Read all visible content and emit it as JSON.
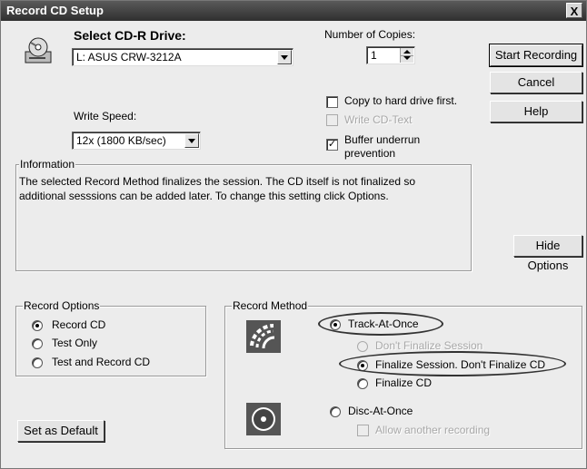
{
  "window": {
    "title": "Record CD Setup",
    "close_glyph": "X"
  },
  "drive": {
    "label": "Select CD-R Drive:",
    "value": "L: ASUS CRW-3212A"
  },
  "speed": {
    "label": "Write Speed:",
    "value": "12x (1800 KB/sec)"
  },
  "copies": {
    "label": "Number of Copies:",
    "value": "1"
  },
  "options": {
    "copy_to_hd": "Copy to hard drive first.",
    "write_cd_text": "Write CD-Text",
    "buffer_line1": "Buffer underrun",
    "buffer_line2": "prevention"
  },
  "buttons": {
    "start": "Start Recording",
    "cancel": "Cancel",
    "help": "Help",
    "hide_options": "Hide Options",
    "set_default": "Set as Default"
  },
  "info": {
    "label": "Information",
    "line1": "The selected Record Method finalizes the session. The CD itself is not finalized so",
    "line2": "additional sesssions can be added later. To change this setting click Options."
  },
  "record_options": {
    "label": "Record Options",
    "items": [
      "Record CD",
      "Test Only",
      "Test and Record CD"
    ],
    "selected": "Record CD"
  },
  "record_method": {
    "label": "Record Method",
    "track_at_once": "Track-At-Once",
    "dont_finalize_session": "Don't Finalize Session",
    "finalize_session": "Finalize Session. Don't Finalize CD",
    "finalize_cd": "Finalize CD",
    "disc_at_once": "Disc-At-Once",
    "allow_another": "Allow another recording"
  },
  "icons": {
    "drive": "cd-drive-icon",
    "track": "track-at-once-icon",
    "disc": "disc-at-once-icon"
  },
  "colors": {
    "title_bar": "#3c3c3c",
    "dialog_bg": "#ececec",
    "annotation": "#333333"
  }
}
